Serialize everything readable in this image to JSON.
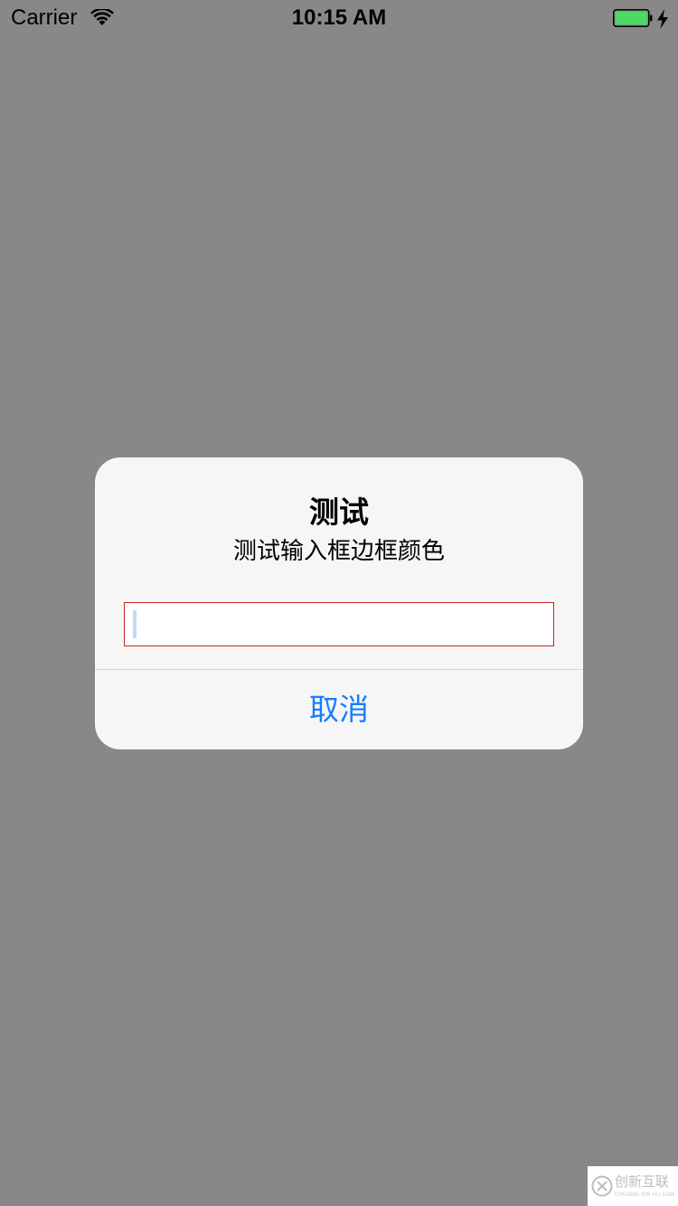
{
  "status_bar": {
    "carrier": "Carrier",
    "time": "10:15 AM",
    "icons": {
      "wifi": "wifi-icon",
      "battery": "battery-icon",
      "charging": "bolt-icon"
    },
    "battery_level": 1.0,
    "battery_color": "#4cd964"
  },
  "alert": {
    "title": "测试",
    "message": "测试输入框边框颜色",
    "input": {
      "value": "",
      "placeholder": "",
      "border_color": "#c4272c",
      "focused": true
    },
    "cancel_label": "取消",
    "button_color": "#157efb"
  },
  "overlay_color": "#888888",
  "watermark": {
    "text": "创新互联",
    "subtext": "CHUANG XIN HU LIAN"
  }
}
